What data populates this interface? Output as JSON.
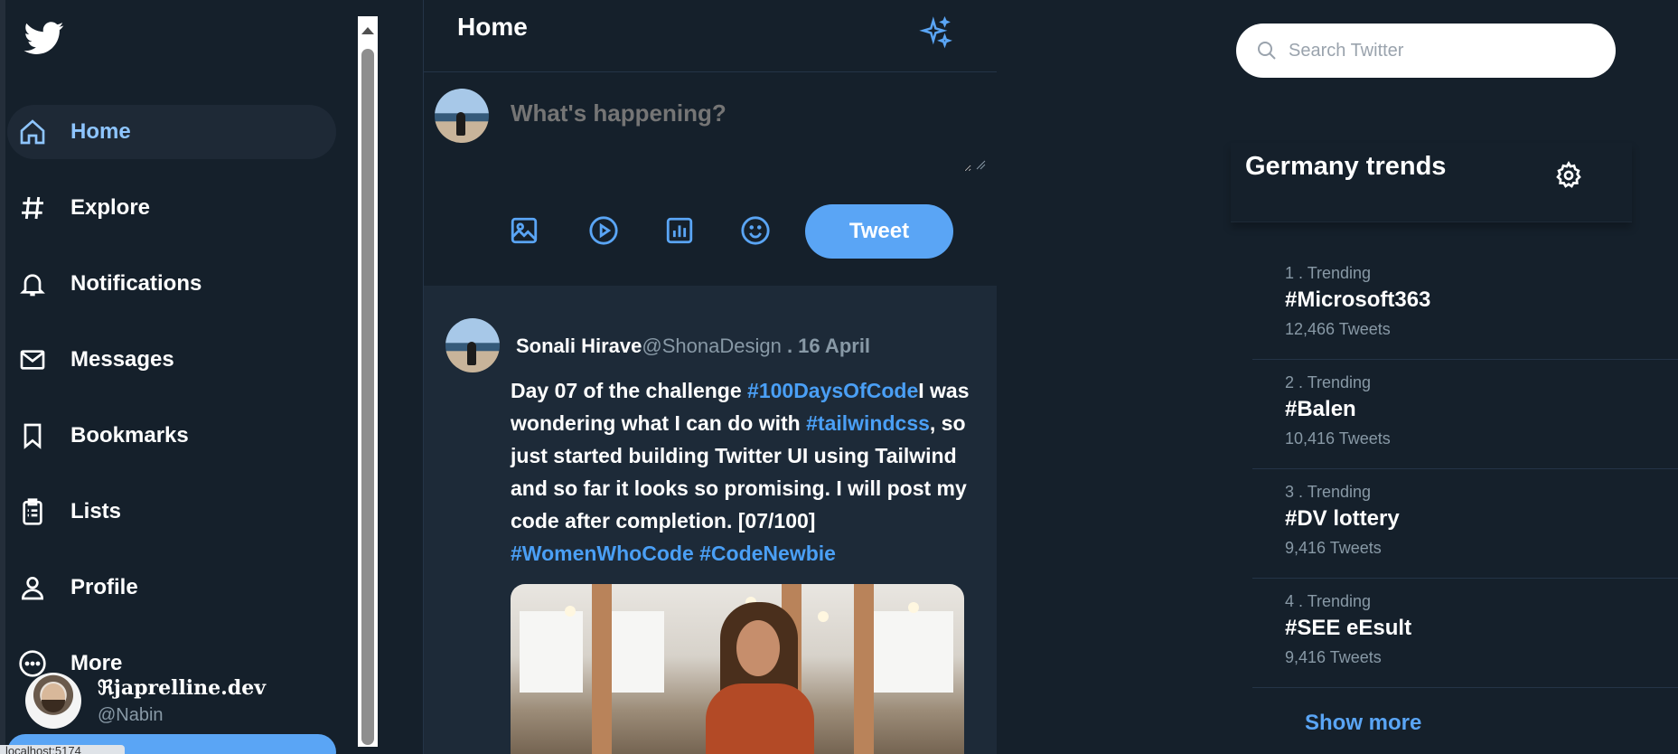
{
  "sidebar": {
    "items": [
      {
        "label": "Home",
        "icon": "home-icon",
        "active": true
      },
      {
        "label": "Explore",
        "icon": "hashtag-icon"
      },
      {
        "label": "Notifications",
        "icon": "bell-icon"
      },
      {
        "label": "Messages",
        "icon": "envelope-icon"
      },
      {
        "label": "Bookmarks",
        "icon": "bookmark-icon"
      },
      {
        "label": "Lists",
        "icon": "clipboard-list-icon"
      },
      {
        "label": "Profile",
        "icon": "user-icon"
      },
      {
        "label": "More",
        "icon": "more-circle-icon"
      }
    ],
    "profile": {
      "name": "ℜjaprelline.dev",
      "handle": "@Nabin"
    },
    "url_tooltip": "localhost:5174"
  },
  "main": {
    "title": "Home",
    "composer": {
      "placeholder": "What's happening?",
      "tweet_button": "Tweet"
    },
    "post": {
      "author": "Sonali Hirave",
      "handle": "@ShonaDesign",
      "date": " . 16 April",
      "text_1": "Day 07 of the challenge ",
      "tag_1": "#100DaysOfCode",
      "text_2": "I was wondering what I can do with ",
      "tag_2": "#tailwindcss",
      "text_3": ", so just started building Twitter UI using Tailwind and so far it looks so promising. I will post my code after completion. [07/100] ",
      "tag_3": "#WomenWhoCode",
      "tag_4": "#CodeNewbie"
    }
  },
  "right": {
    "search_placeholder": "Search Twitter",
    "trends_title": "Germany trends",
    "trends": [
      {
        "meta": "1 . Trending",
        "tag": "#Microsoft363",
        "count": "12,466 Tweets"
      },
      {
        "meta": "2 . Trending",
        "tag": "#Balen",
        "count": "10,416 Tweets"
      },
      {
        "meta": "3 . Trending",
        "tag": "#DV lottery",
        "count": "9,416 Tweets"
      },
      {
        "meta": "4 . Trending",
        "tag": "#SEE eEsult",
        "count": "9,416 Tweets"
      }
    ],
    "show_more": "Show more"
  },
  "colors": {
    "background": "#15202b",
    "accent": "#5aa5f5",
    "muted": "#8899a6",
    "active_nav": "#8ec5ff"
  }
}
